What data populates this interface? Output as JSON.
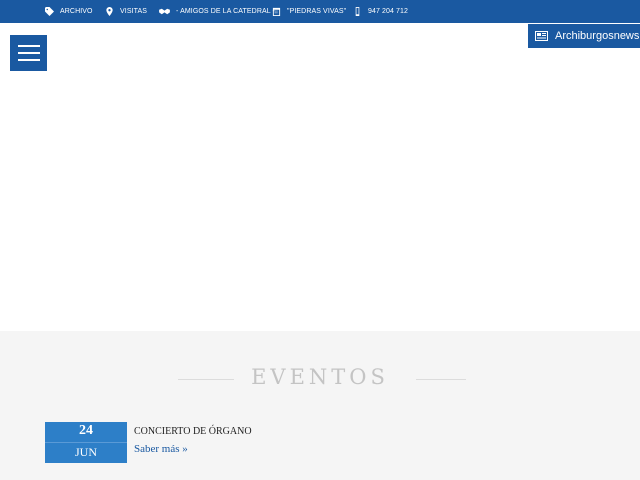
{
  "topbar": {
    "items": [
      {
        "label": "ARCHIVO",
        "icon": "tag-icon"
      },
      {
        "label": "VISITAS",
        "icon": "map-pin-icon"
      },
      {
        "label": "- AMIGOS DE LA CATEDRAL -",
        "icon": "handshake-icon"
      },
      {
        "label": "\"PIEDRAS VIVAS\"",
        "icon": "calendar-icon"
      },
      {
        "label": "947 204 712",
        "icon": "phone-icon"
      }
    ]
  },
  "news_button": {
    "label": "Archiburgosnews",
    "icon": "newspaper-icon"
  },
  "menu": {
    "icon": "hamburger-menu-icon"
  },
  "events": {
    "title": "EVENTOS",
    "items": [
      {
        "day": "24",
        "month": "JUN",
        "title": "CONCIERTO DE ÓRGANO",
        "more_label": "Saber más »"
      }
    ]
  },
  "colors": {
    "brand": "#1a59a1",
    "badge": "#2d7fc8",
    "section_bg": "#f5f5f5",
    "title_gray": "#c4c4c4"
  }
}
